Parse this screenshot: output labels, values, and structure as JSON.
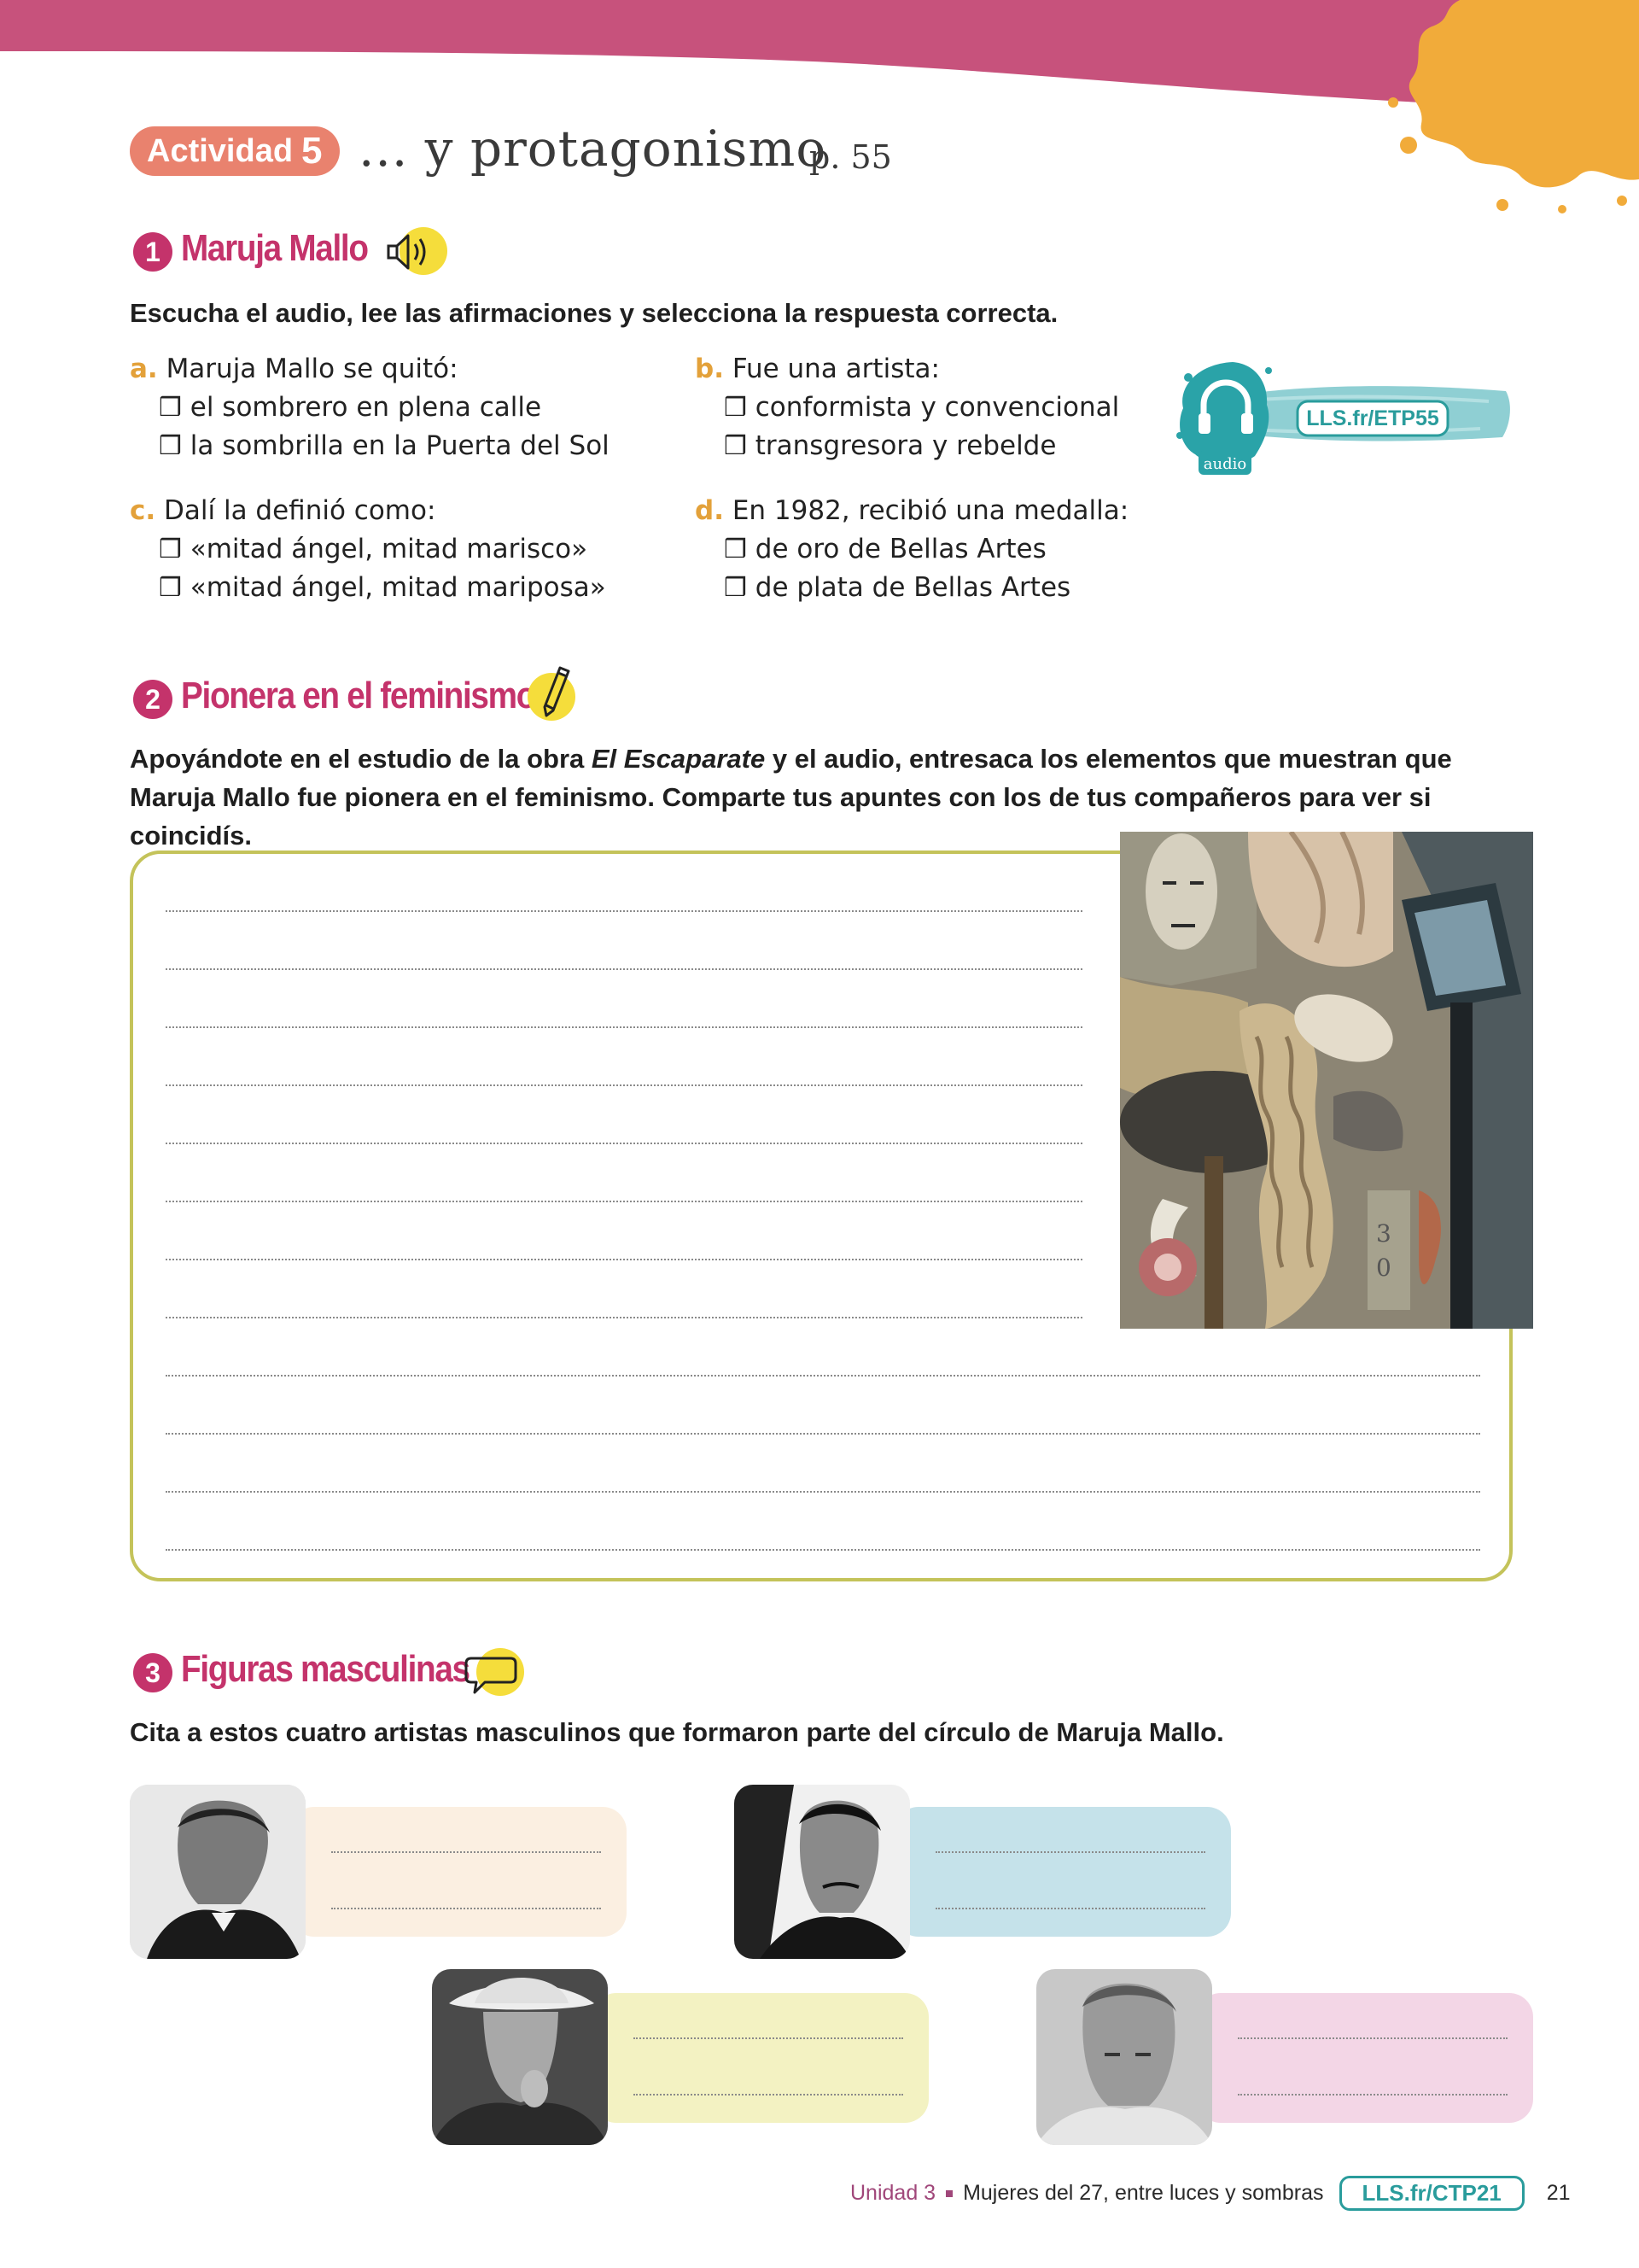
{
  "activity": {
    "badge_label": "Actividad",
    "badge_number": "5",
    "title": "... y protagonismo",
    "page_ref": "p. 55"
  },
  "colors": {
    "header_band": "#c7527c",
    "splash": "#f1ab3a",
    "accent_pink": "#c4336b",
    "accent_orange": "#e3a13a",
    "frame_green": "#c4c35a",
    "teal": "#2a9c9c"
  },
  "section1": {
    "number": "1",
    "title": "Maruja Mallo",
    "icon": "speaker-icon",
    "instruction": "Escucha el audio, lee las afirmaciones y selecciona la respuesta correcta.",
    "questions": [
      {
        "letter": "a.",
        "text": "Maruja Mallo se quitó:",
        "options": [
          "el sombrero en plena calle",
          "la sombrilla en la Puerta del Sol"
        ]
      },
      {
        "letter": "b.",
        "text": "Fue una artista:",
        "options": [
          "conformista y convencional",
          "transgresora y rebelde"
        ]
      },
      {
        "letter": "c.",
        "text": "Dalí la definió como:",
        "options": [
          "«mitad ángel, mitad marisco»",
          "«mitad ángel, mitad mariposa»"
        ]
      },
      {
        "letter": "d.",
        "text": "En 1982, recibió una medalla:",
        "options": [
          "de oro de Bellas Artes",
          "de plata de Bellas Artes"
        ]
      }
    ],
    "checkbox_glyph": "❒",
    "audio_label": "audio",
    "audio_link": "LLS.fr/ETP55"
  },
  "section2": {
    "number": "2",
    "title": "Pionera en el feminismo",
    "icon": "pencil-icon",
    "instruction_before": "Apoyándote en el estudio de la obra ",
    "instruction_italic": "El Escaparate",
    "instruction_after": " y el audio, entresaca los elementos que muestran que Maruja Mallo fue pionera en el feminismo. Comparte tus apuntes con los de tus compañeros para ver si coincidís."
  },
  "section3": {
    "number": "3",
    "title": "Figuras masculinas",
    "icon": "speech-bubble-icon",
    "instruction": "Cita a estos cuatro artistas masculinos que formaron parte del círculo de Maruja Mallo.",
    "cards": [
      {
        "color": "#fbefe1"
      },
      {
        "color": "#c5e2ea"
      },
      {
        "color": "#f3f2c2"
      },
      {
        "color": "#f3d6e6"
      }
    ]
  },
  "footer": {
    "unit": "Unidad 3",
    "subtitle": "Mujeres del 27, entre luces y sombras",
    "link": "LLS.fr/CTP21",
    "page_number": "21"
  }
}
